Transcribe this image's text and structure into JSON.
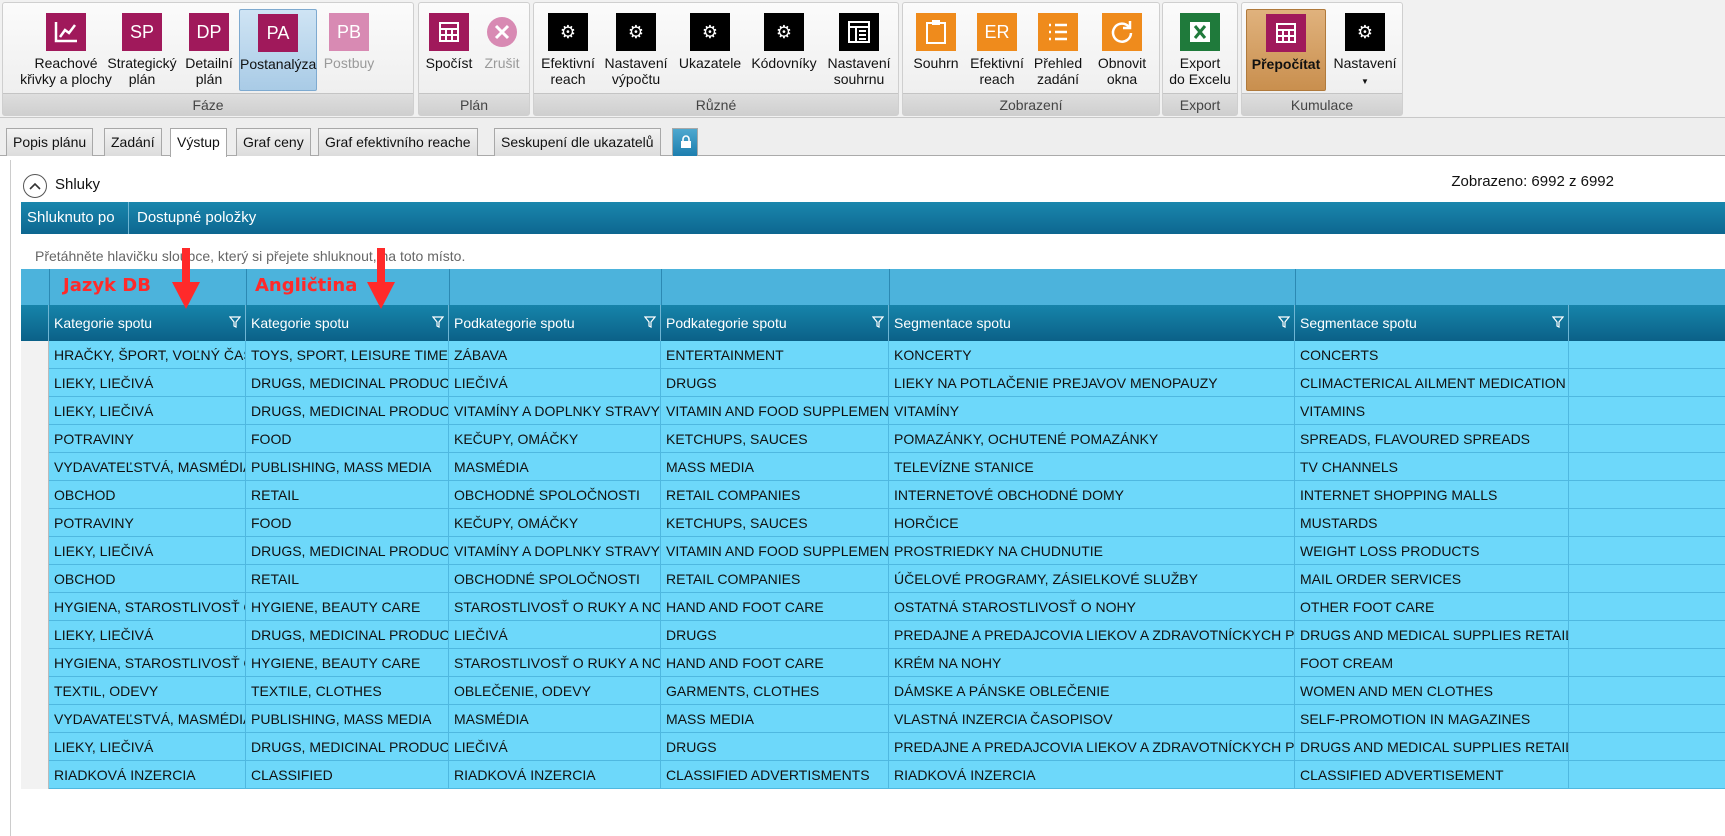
{
  "ribbon": {
    "groups": {
      "faze": "Fáze",
      "plan": "Plán",
      "ruzne": "Různé",
      "zobrazeni": "Zobrazení",
      "export": "Export",
      "kumulace": "Kumulace"
    },
    "buttons": {
      "reachove": "Reachové\nkřivky a plochy",
      "strategicky": "Strategický\nplán",
      "strategicky_icon": "SP",
      "detailni": "Detailní\nplán",
      "detailni_icon": "DP",
      "postanalyza": "Postanalýza",
      "postanalyza_icon": "PA",
      "postbuy": "Postbuy",
      "postbuy_icon": "PB",
      "spocist": "Spočíst",
      "zrusit": "Zrušit",
      "efektivni_reach": "Efektivní\nreach",
      "nastaveni_vypoctu": "Nastavení\nvýpočtu",
      "ukazatele": "Ukazatele",
      "kodovniky": "Kódovníky",
      "nastaveni_souhrnu": "Nastavení\nsouhrnu",
      "souhrn": "Souhrn",
      "efektivni_reach2": "Efektivní\nreach",
      "efektivni_reach2_icon": "ER",
      "prehled_zadani": "Přehled\nzadání",
      "obnovit_okna": "Obnovit\nokna",
      "export_excel": "Export\ndo Excelu",
      "prepocitat": "Přepočítat",
      "nastaveni": "Nastavení"
    }
  },
  "tabs": [
    "Popis plánu",
    "Zadání",
    "Výstup",
    "Graf ceny",
    "Graf efektivního reache",
    "Seskupení dle ukazatelů"
  ],
  "active_tab": "Výstup",
  "panel": {
    "title": "Shluky",
    "shown": "Zobrazeno: 6992 z 6992",
    "group_by_label": "Shluknuto po",
    "available_label": "Dostupné položky",
    "hint": "Přetáhněte hlavičku sloupce, který si přejete shluknout, na toto místo."
  },
  "annotations": {
    "left": "Jazyk DB",
    "right": "Angličtina",
    "color": "#ff2a2a"
  },
  "columns": [
    "Kategorie spotu",
    "Kategorie spotu",
    "Podkategorie spotu",
    "Podkategorie spotu",
    "Segmentace spotu",
    "Segmentace spotu"
  ],
  "rows": [
    [
      "HRAČKY, ŠPORT, VOĽNÝ ČAS",
      "TOYS, SPORT, LEISURE TIME",
      "ZÁBAVA",
      "ENTERTAINMENT",
      "KONCERTY",
      "CONCERTS"
    ],
    [
      "LIEKY, LIEČIVÁ",
      "DRUGS, MEDICINAL PRODUCTS",
      "LIEČIVÁ",
      "DRUGS",
      "LIEKY NA POTLAČENIE PREJAVOV MENOPAUZY",
      "CLIMACTERICAL AILMENT MEDICATION"
    ],
    [
      "LIEKY, LIEČIVÁ",
      "DRUGS, MEDICINAL PRODUCTS",
      "VITAMÍNY A DOPLNKY STRAVY",
      "VITAMIN AND FOOD SUPPLEMENTS",
      "VITAMÍNY",
      "VITAMINS"
    ],
    [
      "POTRAVINY",
      "FOOD",
      "KEČUPY, OMÁČKY",
      "KETCHUPS, SAUCES",
      "POMAZÁNKY, OCHUTENÉ POMAZÁNKY",
      "SPREADS, FLAVOURED SPREADS"
    ],
    [
      "VYDAVATEĽSTVÁ, MASMÉDIA",
      "PUBLISHING, MASS MEDIA",
      "MASMÉDIA",
      "MASS MEDIA",
      "TELEVÍZNE STANICE",
      "TV CHANNELS"
    ],
    [
      "OBCHOD",
      "RETAIL",
      "OBCHODNÉ SPOLOČNOSTI",
      "RETAIL COMPANIES",
      "INTERNETOVÉ OBCHODNÉ DOMY",
      "INTERNET SHOPPING MALLS"
    ],
    [
      "POTRAVINY",
      "FOOD",
      "KEČUPY, OMÁČKY",
      "KETCHUPS, SAUCES",
      "HORČICE",
      "MUSTARDS"
    ],
    [
      "LIEKY, LIEČIVÁ",
      "DRUGS, MEDICINAL PRODUCTS",
      "VITAMÍNY A DOPLNKY STRAVY",
      "VITAMIN AND FOOD SUPPLEMENTS",
      "PROSTRIEDKY NA CHUDNUTIE",
      "WEIGHT LOSS PRODUCTS"
    ],
    [
      "OBCHOD",
      "RETAIL",
      "OBCHODNÉ SPOLOČNOSTI",
      "RETAIL COMPANIES",
      "ÚČELOVÉ PROGRAMY, ZÁSIELKOVÉ SLUŽBY",
      "MAIL ORDER SERVICES"
    ],
    [
      "HYGIENA, STAROSTLIVOSŤ O KRÁSU",
      "HYGIENE, BEAUTY CARE",
      "STAROSTLIVOSŤ O RUKY A NOHY",
      "HAND AND FOOT CARE",
      "OSTATNÁ STAROSTLIVOSŤ O NOHY",
      "OTHER FOOT CARE"
    ],
    [
      "LIEKY, LIEČIVÁ",
      "DRUGS, MEDICINAL PRODUCTS",
      "LIEČIVÁ",
      "DRUGS",
      "PREDAJNE A PREDAJCOVIA LIEKOV A ZDRAVOTNÍCKYCH POTRIEB",
      "DRUGS AND MEDICAL SUPPLIES RETAILERS"
    ],
    [
      "HYGIENA, STAROSTLIVOSŤ O KRÁSU",
      "HYGIENE, BEAUTY CARE",
      "STAROSTLIVOSŤ O RUKY A NOHY",
      "HAND AND FOOT CARE",
      "KRÉM NA NOHY",
      "FOOT CREAM"
    ],
    [
      "TEXTIL, ODEVY",
      "TEXTILE, CLOTHES",
      "OBLEČENIE, ODEVY",
      "GARMENTS, CLOTHES",
      "DÁMSKE A PÁNSKE OBLEČENIE",
      "WOMEN AND MEN CLOTHES"
    ],
    [
      "VYDAVATEĽSTVÁ, MASMÉDIA",
      "PUBLISHING, MASS MEDIA",
      "MASMÉDIA",
      "MASS MEDIA",
      "VLASTNÁ INZERCIA ČASOPISOV",
      "SELF-PROMOTION IN MAGAZINES"
    ],
    [
      "LIEKY, LIEČIVÁ",
      "DRUGS, MEDICINAL PRODUCTS",
      "LIEČIVÁ",
      "DRUGS",
      "PREDAJNE A PREDAJCOVIA LIEKOV A ZDRAVOTNÍCKYCH POTRIEB",
      "DRUGS AND MEDICAL SUPPLIES RETAILERS"
    ],
    [
      "RIADKOVÁ INZERCIA",
      "CLASSIFIED",
      "RIADKOVÁ INZERCIA",
      "CLASSIFIED ADVERTISMENTS",
      "RIADKOVÁ INZERCIA",
      "CLASSIFIED ADVERTISEMENT"
    ]
  ]
}
